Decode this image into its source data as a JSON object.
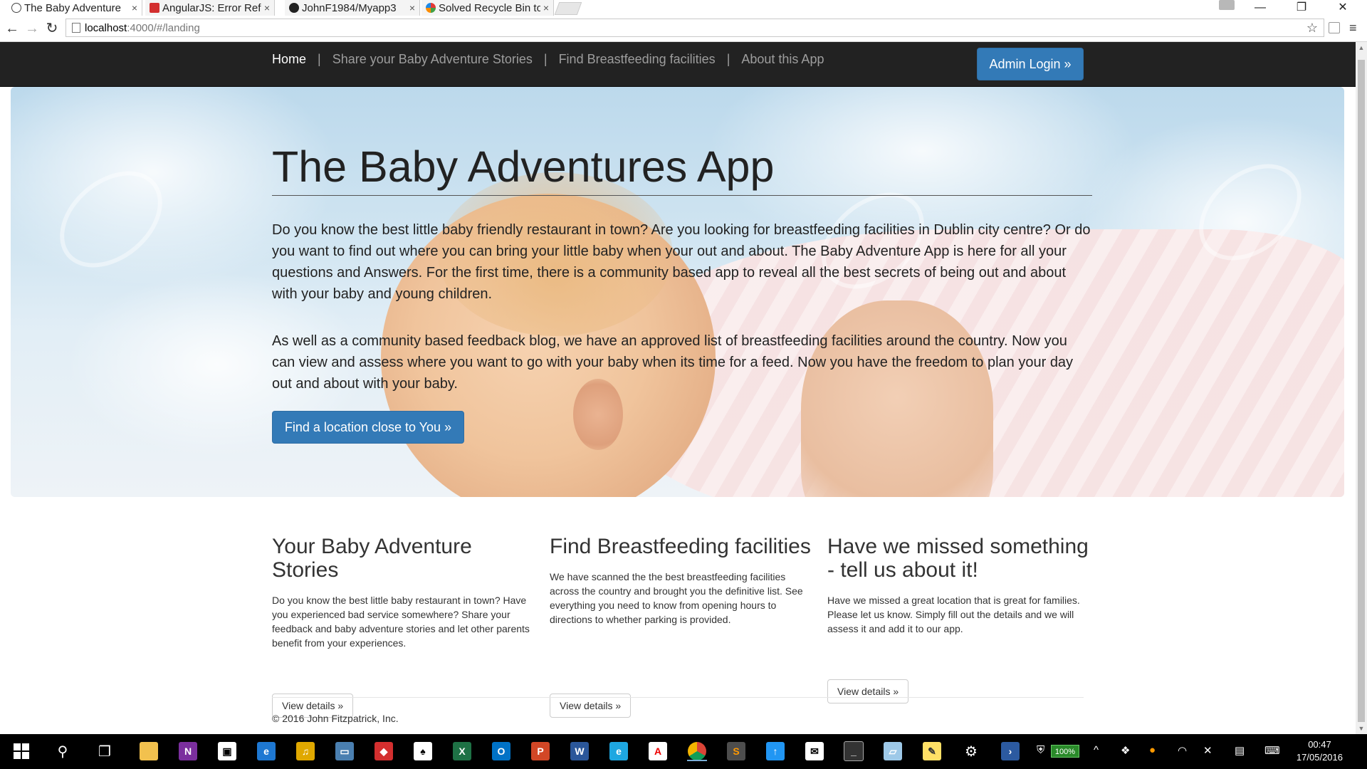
{
  "browser": {
    "tabs": [
      {
        "title": "The Baby Adventure",
        "active": true,
        "icon": "page-icon"
      },
      {
        "title": "AngularJS: Error Refe",
        "active": false,
        "icon": "angular-icon"
      },
      {
        "title": "JohnF1984/Myapp3",
        "active": false,
        "icon": "github-icon"
      },
      {
        "title": "Solved Recycle Bin to",
        "active": false,
        "icon": "site-icon"
      }
    ],
    "tab_close": "×",
    "window_controls": {
      "minimize": "—",
      "restore": "❐",
      "close": "✕"
    },
    "url_host": "localhost",
    "url_path": ":4000/#/landing"
  },
  "navbar": {
    "links": [
      {
        "label": "Home",
        "active": true
      },
      {
        "label": "Share your Baby Adventure Stories",
        "active": false
      },
      {
        "label": "Find Breastfeeding facilities",
        "active": false
      },
      {
        "label": "About this App",
        "active": false
      }
    ],
    "separator": "|",
    "admin_button": "Admin Login »"
  },
  "jumbotron": {
    "title": "The Baby Adventures App",
    "paragraph1": "Do you know the best little baby friendly restaurant in town? Are you looking for breastfeeding facilities in Dublin city centre? Or do you want to find out where you can bring your little baby when your out and about. The Baby Adventure App is here for all your questions and Answers. For the first time, there is a community based app to reveal all the best secrets of being out and about with your baby and young children.",
    "paragraph2": "As well as a community based feedback blog, we have an approved list of breastfeeding facilities around the country. Now you can view and assess where you want to go with your baby when its time for a feed. Now you have the freedom to plan your day out and about with your baby.",
    "button": "Find a location close to You »"
  },
  "columns": [
    {
      "heading": "Your Baby Adventure Stories",
      "text": "Do you know the best little baby restaurant in town? Have you experienced bad service somewhere? Share your feedback and baby adventure stories and let other parents benefit from your experiences.",
      "button": "View details »"
    },
    {
      "heading": "Find Breastfeeding facilities",
      "text": "We have scanned the the best breastfeeding facilities across the country and brought you the definitive list. See everything you need to know from opening hours to directions to whether parking is provided.",
      "button": "View details »"
    },
    {
      "heading": "Have we missed something - tell us about it!",
      "text": "Have we missed a great location that is great for families. Please let us know. Simply fill out the details and we will assess it and add it to our app.",
      "button": "View details »"
    }
  ],
  "footer": {
    "text": "© 2016 John Fitzpatrick, Inc."
  },
  "taskbar": {
    "battery": "100%",
    "time": "00:47",
    "date": "17/05/2016"
  },
  "colors": {
    "navbar_bg": "#222222",
    "primary_button": "#337ab7",
    "taskbar_bg": "#000000"
  }
}
